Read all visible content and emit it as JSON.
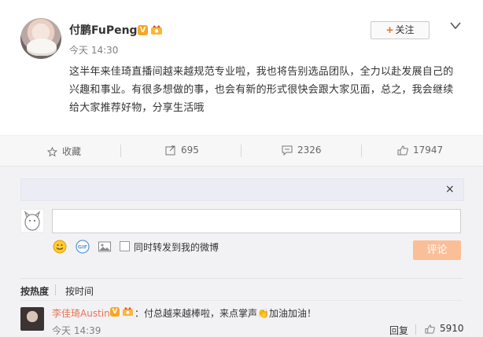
{
  "post": {
    "author": "付鹏FuPeng",
    "verified_badge": "V",
    "time": "今天 14:30",
    "follow_label": "关注",
    "follow_plus": "+",
    "content": "这半年来佳琦直播间越来越规范专业啦，我也将告别选品团队，全力以赴发展自己的兴趣和事业。有很多想做的事，也会有新的形式很快会跟大家见面，总之，我会继续给大家推荐好物，分享生活哦"
  },
  "actions": {
    "favorite_label": "收藏",
    "repost_count": "695",
    "comment_count": "2326",
    "like_count": "17947"
  },
  "comment_box": {
    "close_glyph": "×",
    "checkbox_label": "同时转发到我的微博",
    "submit_label": "评论"
  },
  "sort": {
    "hot": "按热度",
    "time": "按时间"
  },
  "comments": [
    {
      "author": "李佳琦Austin",
      "verified_badge": "V",
      "text": "：付总越来越棒啦，来点掌声👏加油加油！",
      "time": "今天 14:39",
      "reply_label": "回复",
      "likes": "5910"
    }
  ],
  "colors": {
    "accent_orange": "#eb7350",
    "submit_disabled": "#fbbf98",
    "verified_gold": "#f6a623"
  }
}
